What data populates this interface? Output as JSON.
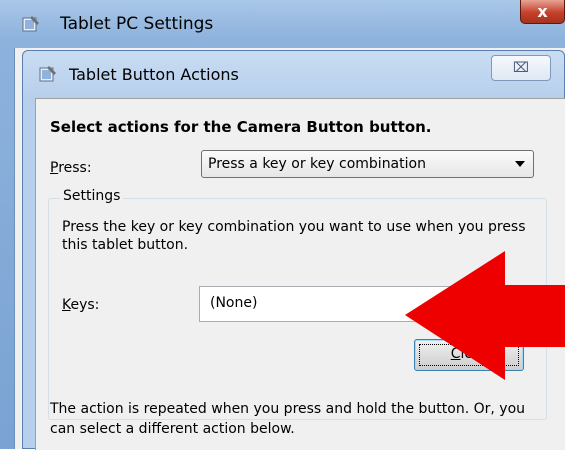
{
  "outer_window": {
    "title": "Tablet PC Settings",
    "close_glyph": "x"
  },
  "dialog": {
    "title": "Tablet Button Actions",
    "close_glyph": "⌧",
    "heading": "Select actions for the Camera Button button.",
    "press": {
      "label_accel": "P",
      "label_rest": "ress:",
      "selected": "Press a key or key combination"
    },
    "settings_group": {
      "label": "Settings",
      "description": "Press the key or key combination you want to use when you press this tablet button.",
      "keys_label_accel": "K",
      "keys_label_rest": "eys:",
      "keys_value": "(None)",
      "clear_button_accel": "C",
      "clear_button_rest": "lear"
    },
    "footer": "The action is repeated when you press and hold the button. Or, you can select a different action below."
  },
  "colors": {
    "arrow": "#ee0000",
    "titlebar": "#a9c7e8",
    "dialog_bg": "#f0f0f0"
  }
}
